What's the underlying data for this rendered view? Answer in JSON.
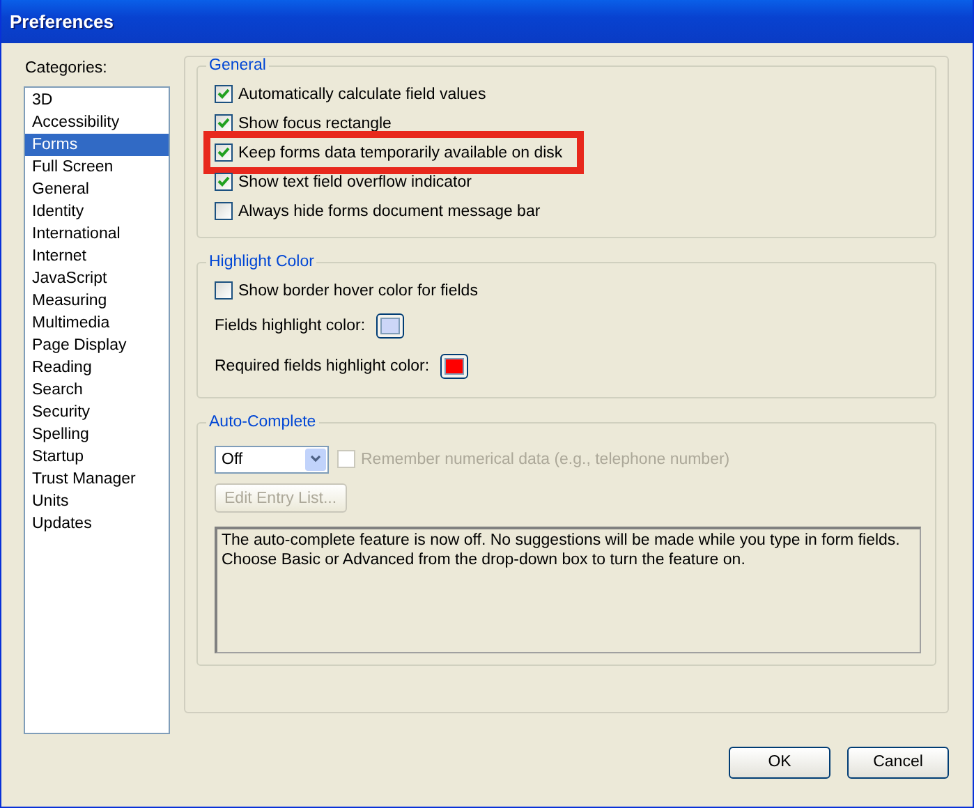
{
  "window": {
    "title": "Preferences"
  },
  "categories": {
    "label": "Categories:",
    "items": [
      {
        "label": "3D",
        "selected": false
      },
      {
        "label": "Accessibility",
        "selected": false
      },
      {
        "label": "Forms",
        "selected": true
      },
      {
        "label": "Full Screen",
        "selected": false
      },
      {
        "label": "General",
        "selected": false
      },
      {
        "label": "Identity",
        "selected": false
      },
      {
        "label": "International",
        "selected": false
      },
      {
        "label": "Internet",
        "selected": false
      },
      {
        "label": "JavaScript",
        "selected": false
      },
      {
        "label": "Measuring",
        "selected": false
      },
      {
        "label": "Multimedia",
        "selected": false
      },
      {
        "label": "Page Display",
        "selected": false
      },
      {
        "label": "Reading",
        "selected": false
      },
      {
        "label": "Search",
        "selected": false
      },
      {
        "label": "Security",
        "selected": false
      },
      {
        "label": "Spelling",
        "selected": false
      },
      {
        "label": "Startup",
        "selected": false
      },
      {
        "label": "Trust Manager",
        "selected": false
      },
      {
        "label": "Units",
        "selected": false
      },
      {
        "label": "Updates",
        "selected": false
      }
    ]
  },
  "general": {
    "title": "General",
    "options": [
      {
        "label": "Automatically calculate field values",
        "checked": true,
        "highlighted": false
      },
      {
        "label": "Show focus rectangle",
        "checked": true,
        "highlighted": false
      },
      {
        "label": "Keep forms data temporarily available on disk",
        "checked": true,
        "highlighted": true
      },
      {
        "label": "Show text field overflow indicator",
        "checked": true,
        "highlighted": false
      },
      {
        "label": "Always hide forms document message bar",
        "checked": false,
        "highlighted": false
      }
    ]
  },
  "highlight_color": {
    "title": "Highlight Color",
    "option": {
      "label": "Show border hover color for fields",
      "checked": false
    },
    "swatches": [
      {
        "label": "Fields highlight color:",
        "color": "#ccd6f8"
      },
      {
        "label": "Required fields highlight color:",
        "color": "#ff0000"
      }
    ]
  },
  "auto_complete": {
    "title": "Auto-Complete",
    "dropdown": {
      "value": "Off"
    },
    "option": {
      "label": "Remember numerical data (e.g., telephone number)",
      "checked": false,
      "disabled": true
    },
    "button": {
      "label": "Edit Entry List...",
      "disabled": true
    },
    "description": "The auto-complete feature is now off. No suggestions will be made while you type in form fields. Choose Basic or Advanced from the drop-down box to turn the feature on."
  },
  "buttons": [
    "OK",
    "Cancel"
  ]
}
